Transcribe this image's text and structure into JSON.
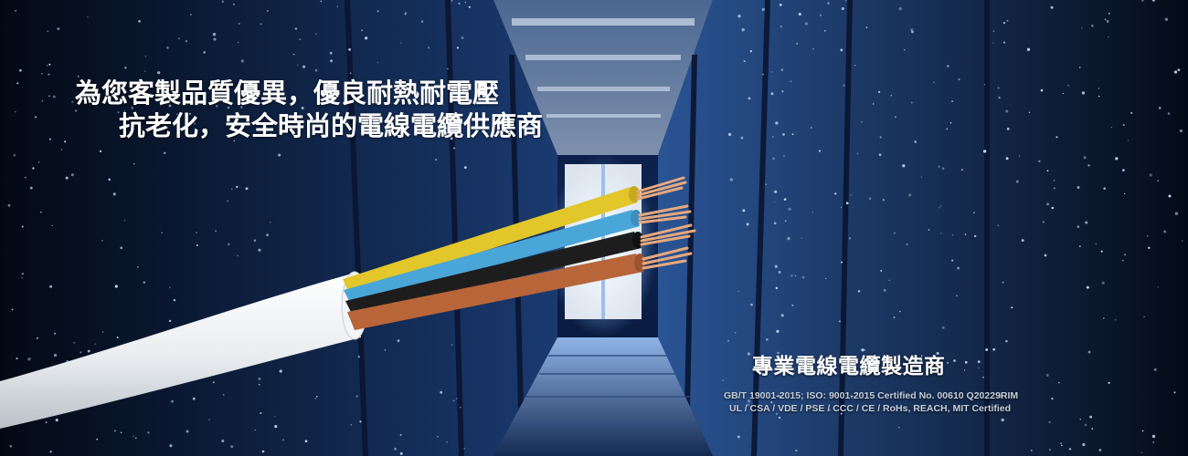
{
  "banner": {
    "headline_line1": "為您客製品質優異，優良耐熱耐電壓",
    "headline_line2": "抗老化，安全時尚的電線電纜供應商",
    "tagline": "專業電線電纜製造商",
    "certifications_line1": "GB/T 19001-2015; ISO: 9001-2015 Certified No. 00610 Q20229RIM",
    "certifications_line2": "UL / CSA / VDE / PSE / CCC / CE / RoHs, REACH, MIT Certified"
  },
  "cable": {
    "jacket_color": "#eef0f2",
    "wire_colors": [
      "#e2c62a",
      "#4aa6d8",
      "#1d1d1d",
      "#b8653a"
    ],
    "copper_color": "#e8a87c"
  },
  "colors": {
    "background": "#0a1a3a",
    "glow": "#cfe4ff"
  }
}
